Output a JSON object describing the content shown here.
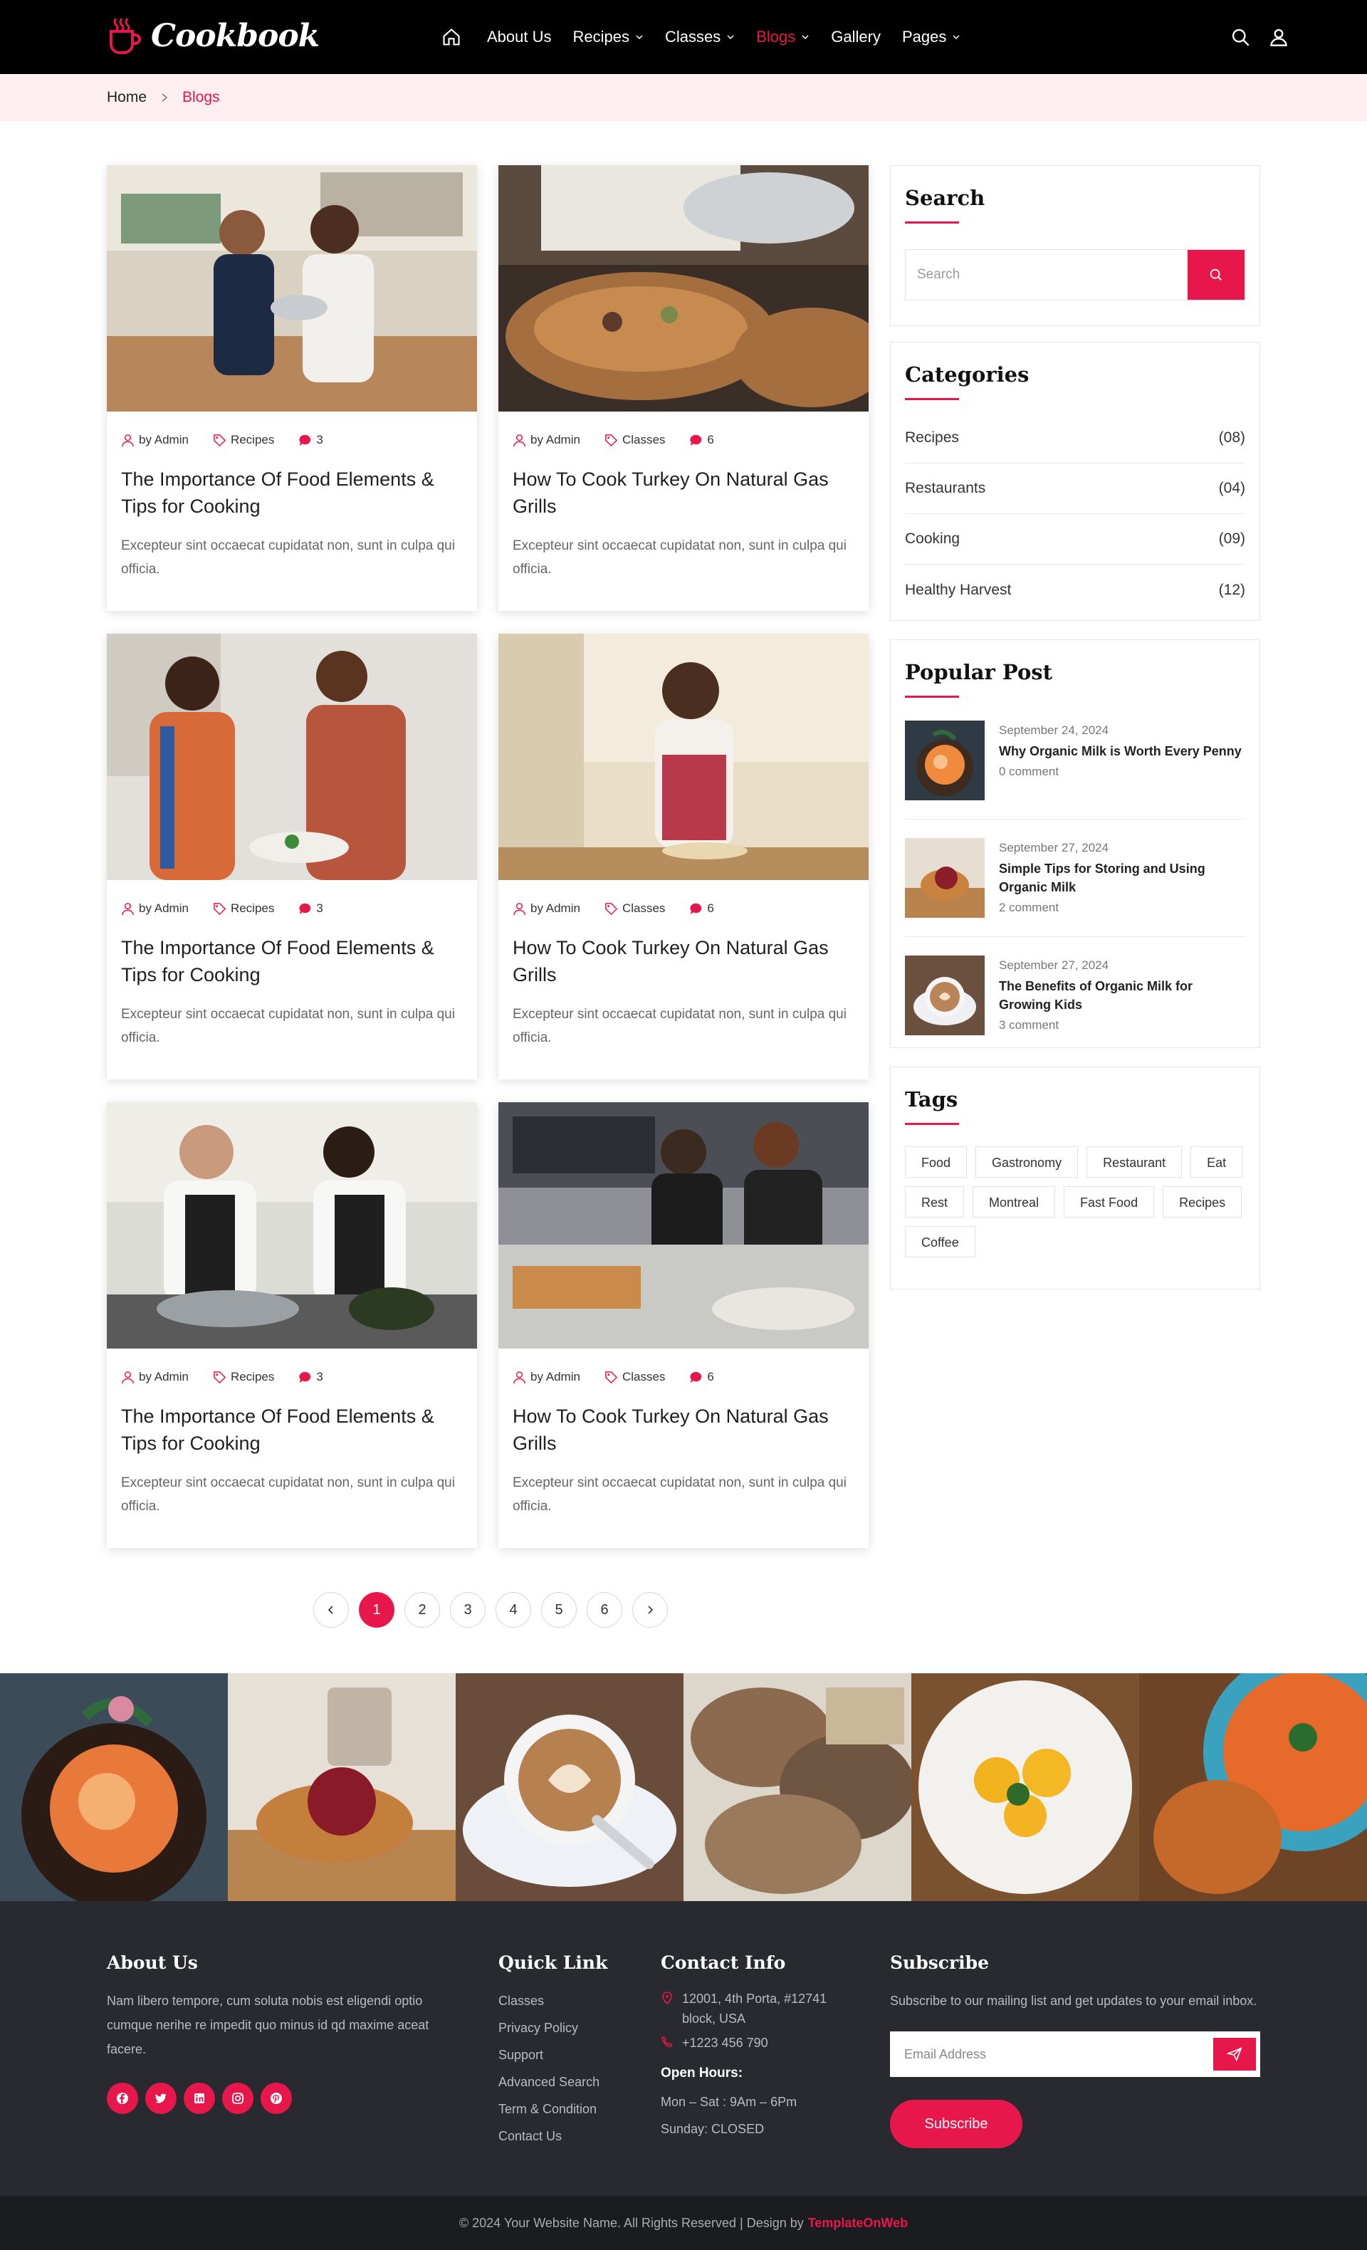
{
  "header": {
    "logo_text": "Cookbook",
    "nav": [
      {
        "label": "About Us",
        "has_dropdown": false
      },
      {
        "label": "Recipes",
        "has_dropdown": true
      },
      {
        "label": "Classes",
        "has_dropdown": true
      },
      {
        "label": "Blogs",
        "has_dropdown": true,
        "active": true
      },
      {
        "label": "Gallery",
        "has_dropdown": false
      },
      {
        "label": "Pages",
        "has_dropdown": true
      }
    ]
  },
  "breadcrumb": {
    "home": "Home",
    "current": "Blogs"
  },
  "posts": [
    {
      "author": "by Admin",
      "category": "Recipes",
      "comments": "3",
      "title": "The Importance Of Food Elements & Tips for Cooking",
      "excerpt": "Excepteur sint occaecat cupidatat non, sunt in culpa qui officia."
    },
    {
      "author": "by Admin",
      "category": "Classes",
      "comments": "6",
      "title": "How To Cook Turkey On Natural Gas Grills",
      "excerpt": "Excepteur sint occaecat cupidatat non, sunt in culpa qui officia."
    },
    {
      "author": "by Admin",
      "category": "Recipes",
      "comments": "3",
      "title": "The Importance Of Food Elements & Tips for Cooking",
      "excerpt": "Excepteur sint occaecat cupidatat non, sunt in culpa qui officia."
    },
    {
      "author": "by Admin",
      "category": "Classes",
      "comments": "6",
      "title": "How To Cook Turkey On Natural Gas Grills",
      "excerpt": "Excepteur sint occaecat cupidatat non, sunt in culpa qui officia."
    },
    {
      "author": "by Admin",
      "category": "Recipes",
      "comments": "3",
      "title": "The Importance Of Food Elements & Tips for Cooking",
      "excerpt": "Excepteur sint occaecat cupidatat non, sunt in culpa qui officia."
    },
    {
      "author": "by Admin",
      "category": "Classes",
      "comments": "6",
      "title": "How To Cook Turkey On Natural Gas Grills",
      "excerpt": "Excepteur sint occaecat cupidatat non, sunt in culpa qui officia."
    }
  ],
  "pagination": {
    "pages": [
      "1",
      "2",
      "3",
      "4",
      "5",
      "6"
    ],
    "current": "1"
  },
  "sidebar": {
    "search": {
      "title": "Search",
      "placeholder": "Search"
    },
    "categories": {
      "title": "Categories",
      "items": [
        {
          "label": "Recipes",
          "count": "(08)"
        },
        {
          "label": "Restaurants",
          "count": "(04)"
        },
        {
          "label": "Cooking",
          "count": "(09)"
        },
        {
          "label": "Healthy Harvest",
          "count": "(12)"
        }
      ]
    },
    "popular": {
      "title": "Popular Post",
      "items": [
        {
          "date": "September 24, 2024",
          "title": "Why Organic Milk is Worth Every Penny",
          "comments": "0 comment"
        },
        {
          "date": "September 27, 2024",
          "title": "Simple Tips for Storing and Using Organic Milk",
          "comments": "2 comment"
        },
        {
          "date": "September 27, 2024",
          "title": "The Benefits of Organic Milk for Growing Kids",
          "comments": "3 comment"
        }
      ]
    },
    "tags": {
      "title": "Tags",
      "items": [
        "Food",
        "Gastronomy",
        "Restaurant",
        "Eat",
        "Rest",
        "Montreal",
        "Fast Food",
        "Recipes",
        "Coffee"
      ]
    }
  },
  "footer": {
    "about": {
      "title": "About Us",
      "text": "Nam libero tempore, cum soluta nobis est eligendi optio cumque nerihe re impedit quo minus id qd maxime aceat facere."
    },
    "quick": {
      "title": "Quick Link",
      "links": [
        "Classes",
        "Privacy Policy",
        "Support",
        "Advanced Search",
        "Term & Condition",
        "Contact Us"
      ]
    },
    "contact": {
      "title": "Contact Info",
      "address": "12001, 4th Porta, #12741 block, USA",
      "phone": "+1223 456 790",
      "hours_title": "Open Hours:",
      "hours_1": "Mon – Sat : 9Am – 6Pm",
      "hours_2": "Sunday: CLOSED"
    },
    "subscribe": {
      "title": "Subscribe",
      "text": "Subscribe to our mailing list and get updates to your email inbox.",
      "placeholder": "Email Address",
      "button": "Subscribe"
    },
    "copyright": "© 2024 Your Website Name. All Rights Reserved | Design by",
    "designer": "TemplateOnWeb"
  },
  "colors": {
    "accent": "#e8174b",
    "header_bg": "#000000",
    "footer_bg": "#282a2f",
    "breadcrumb_bg": "#fdeff1"
  }
}
